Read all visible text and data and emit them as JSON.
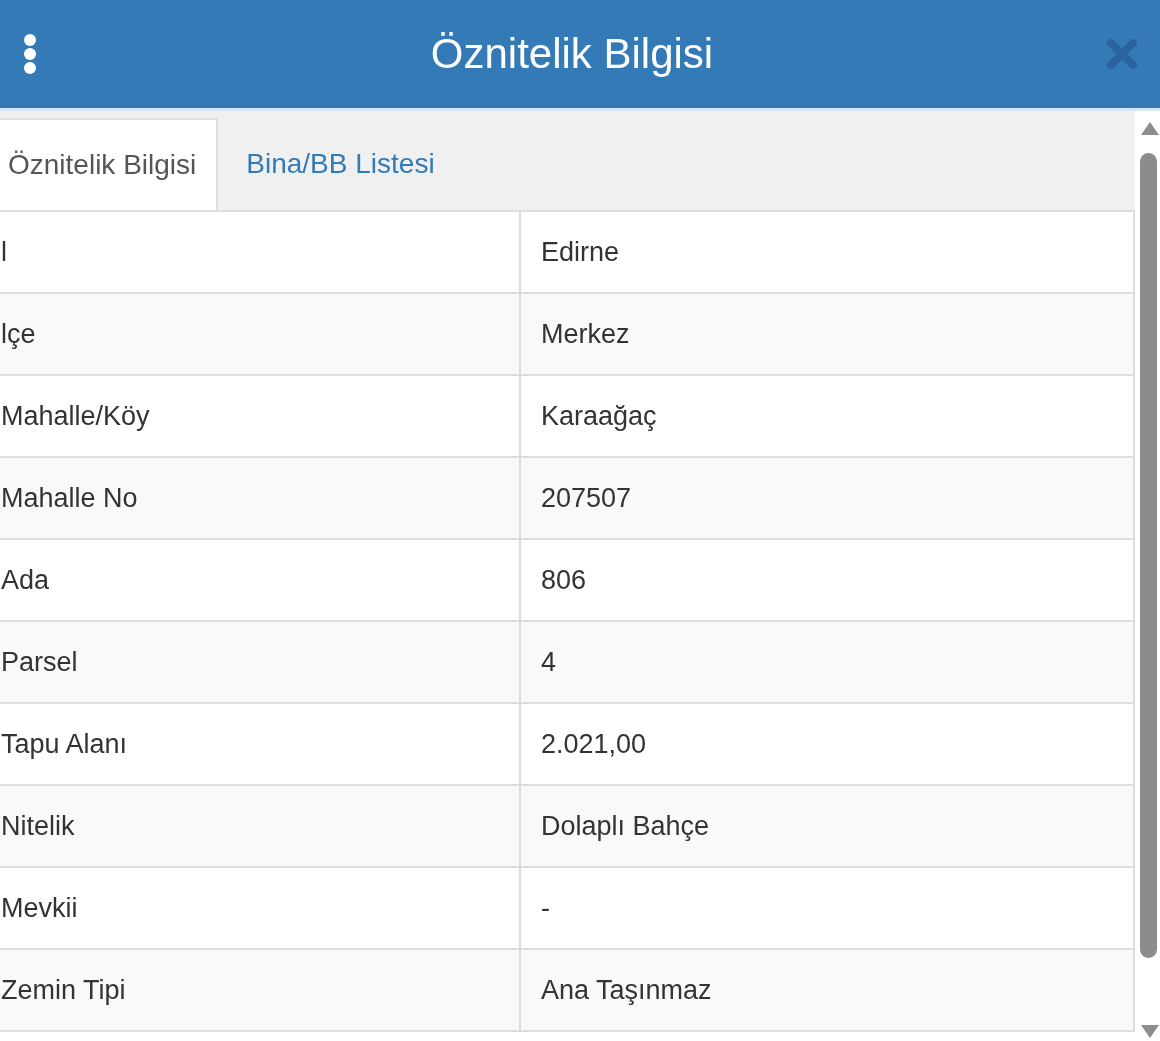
{
  "dialog": {
    "title": "Öznitelik Bilgisi"
  },
  "tabs": [
    {
      "label": "Öznitelik Bilgisi",
      "selected": true
    },
    {
      "label": "Bina/BB Listesi",
      "selected": false
    }
  ],
  "attributes": [
    {
      "field": "l",
      "value": "Edirne"
    },
    {
      "field": "lçe",
      "value": "Merkez"
    },
    {
      "field": "Mahalle/Köy",
      "value": "Karaağaç"
    },
    {
      "field": "Mahalle No",
      "value": "207507"
    },
    {
      "field": "Ada",
      "value": "806"
    },
    {
      "field": "Parsel",
      "value": "4"
    },
    {
      "field": "Tapu Alanı",
      "value": "2.021,00"
    },
    {
      "field": "Nitelik",
      "value": "Dolaplı Bahçe"
    },
    {
      "field": "Mevkii",
      "value": "-"
    },
    {
      "field": "Zemin Tipi",
      "value": "Ana Taşınmaz"
    }
  ]
}
